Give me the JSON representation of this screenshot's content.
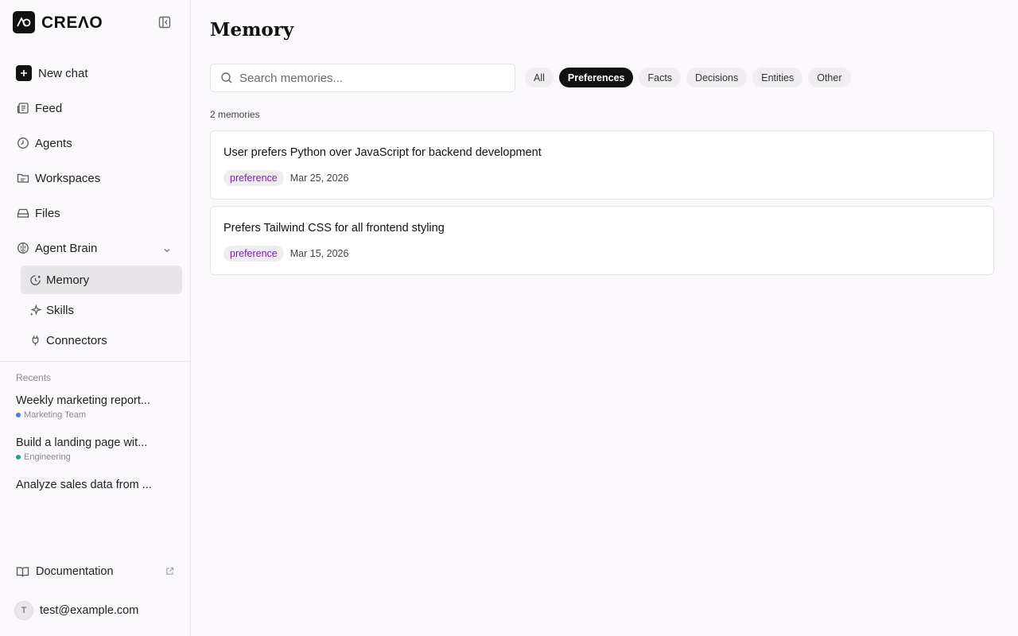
{
  "brand": {
    "name": "CREΛO"
  },
  "nav": {
    "new_chat": "New chat",
    "feed": "Feed",
    "agents": "Agents",
    "workspaces": "Workspaces",
    "files": "Files",
    "agent_brain": "Agent Brain",
    "sub": {
      "memory": "Memory",
      "skills": "Skills",
      "connectors": "Connectors"
    }
  },
  "recents": {
    "label": "Recents",
    "items": [
      {
        "title": "Weekly marketing report...",
        "tag": "Marketing Team",
        "tag_color": "#4a7fd6"
      },
      {
        "title": "Build a landing page wit...",
        "tag": "Engineering",
        "tag_color": "#2a9d8f"
      },
      {
        "title": "Analyze sales data from ...",
        "tag": ""
      }
    ]
  },
  "footer": {
    "documentation": "Documentation",
    "user_initial": "T",
    "user_email": "test@example.com"
  },
  "main": {
    "title": "Memory",
    "search_placeholder": "Search memories...",
    "filters": [
      "All",
      "Preferences",
      "Facts",
      "Decisions",
      "Entities",
      "Other"
    ],
    "active_filter": "Preferences",
    "count": "2 memories",
    "memories": [
      {
        "title": "User prefers Python over JavaScript for backend development",
        "badge": "preference",
        "date": "Mar 25, 2026"
      },
      {
        "title": "Prefers Tailwind CSS for all frontend styling",
        "badge": "preference",
        "date": "Mar 15, 2026"
      }
    ]
  },
  "colors": {
    "accent_dark": "#111111",
    "badge_text": "#7a1fb5",
    "background": "#faf8fb"
  }
}
